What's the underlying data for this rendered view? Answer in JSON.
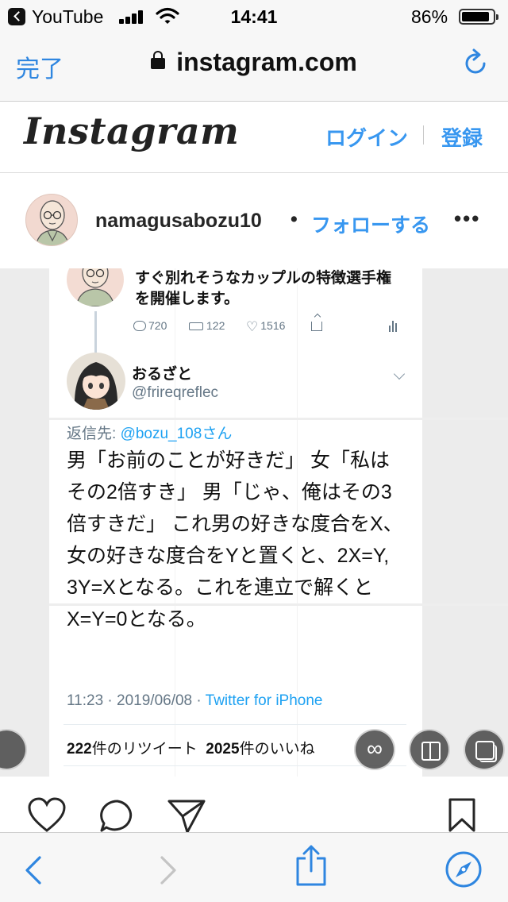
{
  "status_bar": {
    "back_app": "YouTube",
    "time": "14:41",
    "battery": "86%"
  },
  "browser": {
    "done_label": "完了",
    "url": "instagram.com"
  },
  "instagram": {
    "logo": "Instagram",
    "login_label": "ログイン",
    "signup_label": "登録"
  },
  "post_header": {
    "username": "namagusabozu10",
    "separator": "•",
    "follow_label": "フォローする",
    "more_label": "•••"
  },
  "tweet": {
    "original_text": "すぐ別れそうなカップルの特徴選手権を開催します。",
    "reply_count": "720",
    "retweet_count": "122",
    "like_count": "1516",
    "reply_author_name": "おるざと",
    "reply_author_handle": "@frireqreflec",
    "reply_to_prefix": "返信先: ",
    "reply_to_mention": "@bozu_108さん",
    "body": "男「お前のことが好きだ」 女「私はその2倍すき」 男「じゃ、俺はその3倍すきだ」 これ男の好きな度合をX、女の好きな度合をYと置くと、2X=Y, 3Y=Xとなる。これを連立で解くとX=Y=0となる。",
    "timestamp": "11:23 · 2019/06/08 · ",
    "source": "Twitter for iPhone",
    "retweets_number": "222",
    "retweets_label": "件のリツイート",
    "likes_number": "2025",
    "likes_label": "件のいいね"
  },
  "colors": {
    "accent": "#3897f0",
    "twitter_blue": "#1da1f2",
    "safari_blue": "#2f86e0"
  }
}
